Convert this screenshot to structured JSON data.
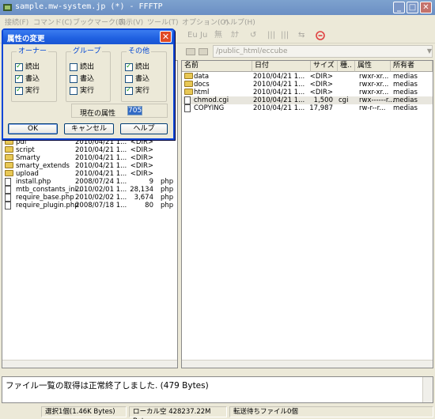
{
  "window": {
    "title": "sample.mw-system.jp (*) - FFFTP",
    "minimize": "_",
    "maximize": "□",
    "close": "✕"
  },
  "menu": [
    "接続(F)",
    "コマンド(C)",
    "ブックマーク(B)",
    "表示(V)",
    "ツール(T)",
    "オプション(O)",
    "ヘルプ(H)"
  ],
  "toolbar": {
    "items": [
      "Eu",
      "Ju",
      "無",
      "ｶﾅ",
      "↺",
      "|||",
      "|||",
      "⇆"
    ]
  },
  "remote": {
    "path": "/public_html/eccube",
    "columns": [
      "名前",
      "日付",
      "サイズ",
      "種..",
      "属性",
      "所有者"
    ],
    "files": [
      {
        "name": "data",
        "date": "2010/04/21 1...",
        "size": "<DIR>",
        "type": "",
        "attr": "rwxr-xr...",
        "owner": "medias",
        "kind": "folder"
      },
      {
        "name": "docs",
        "date": "2010/04/21 1...",
        "size": "<DIR>",
        "type": "",
        "attr": "rwxr-xr...",
        "owner": "medias",
        "kind": "folder"
      },
      {
        "name": "html",
        "date": "2010/04/21 1...",
        "size": "<DIR>",
        "type": "",
        "attr": "rwxr-xr...",
        "owner": "medias",
        "kind": "folder"
      },
      {
        "name": "chmod.cgi",
        "date": "2010/04/21 1...",
        "size": "1,500",
        "type": "cgi",
        "attr": "rwx------r...",
        "owner": "medias",
        "kind": "file",
        "selected": true
      },
      {
        "name": "COPYING",
        "date": "2010/04/21 1...",
        "size": "17,987",
        "type": "",
        "attr": "rw-r--r...",
        "owner": "medias",
        "kind": "file"
      }
    ]
  },
  "local": {
    "files": [
      {
        "name": "pdf",
        "date": "2010/04/21 1...",
        "size": "<DIR>",
        "type": "",
        "kind": "folder"
      },
      {
        "name": "script",
        "date": "2010/04/21 1...",
        "size": "<DIR>",
        "type": "",
        "kind": "folder"
      },
      {
        "name": "Smarty",
        "date": "2010/04/21 1...",
        "size": "<DIR>",
        "type": "",
        "kind": "folder"
      },
      {
        "name": "smarty_extends",
        "date": "2010/04/21 1...",
        "size": "<DIR>",
        "type": "",
        "kind": "folder"
      },
      {
        "name": "upload",
        "date": "2010/04/21 1...",
        "size": "<DIR>",
        "type": "",
        "kind": "folder"
      },
      {
        "name": "install.php",
        "date": "2008/07/24 1...",
        "size": "9",
        "type": "php",
        "kind": "file"
      },
      {
        "name": "mtb_constants_ini...",
        "date": "2010/02/01 1...",
        "size": "28,134",
        "type": "php",
        "kind": "file"
      },
      {
        "name": "require_base.php",
        "date": "2010/02/02 1...",
        "size": "3,674",
        "type": "php",
        "kind": "file"
      },
      {
        "name": "require_plugin.php",
        "date": "2008/07/18 1...",
        "size": "80",
        "type": "php",
        "kind": "file"
      }
    ]
  },
  "dialog": {
    "title": "属性の変更",
    "close": "✕",
    "groups": [
      {
        "title": "オーナー",
        "items": [
          {
            "label": "読出",
            "checked": true
          },
          {
            "label": "書込",
            "checked": true
          },
          {
            "label": "実行",
            "checked": true
          }
        ]
      },
      {
        "title": "グループ",
        "items": [
          {
            "label": "読出",
            "checked": false
          },
          {
            "label": "書込",
            "checked": false
          },
          {
            "label": "実行",
            "checked": false
          }
        ]
      },
      {
        "title": "その他",
        "items": [
          {
            "label": "読出",
            "checked": true
          },
          {
            "label": "書込",
            "checked": false
          },
          {
            "label": "実行",
            "checked": true
          }
        ]
      }
    ],
    "current_attr_label": "現在の属性",
    "current_attr_value": "705",
    "ok": "OK",
    "cancel": "キャンセル",
    "help": "ヘルプ"
  },
  "log": {
    "text": "ファイル一覧の取得は正常終了しました. (479 Bytes)"
  },
  "status": {
    "selected": "選択1個(1.46K Bytes)",
    "local_free": "ローカル空 428237.22M Bytes",
    "transfer_wait": "転送待ちファイル0個"
  },
  "colors": {
    "title_active": "#1e5fe0",
    "dialog_border": "#0a46d8",
    "group_title": "#0046d5",
    "check_mark": "#21a121"
  }
}
